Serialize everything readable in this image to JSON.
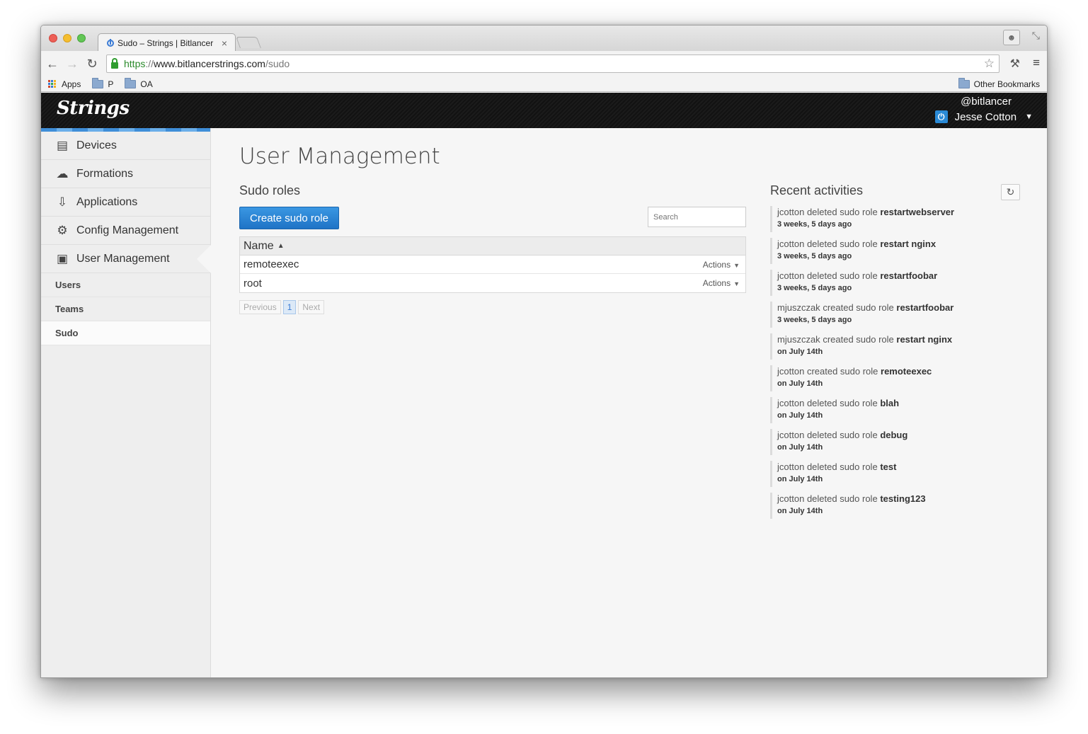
{
  "browser": {
    "tab_title": "Sudo – Strings | Bitlancer",
    "url_scheme": "https",
    "url_sep": "://",
    "url_host": "www.bitlancerstrings.com",
    "url_path": "/sudo",
    "bookmarks": [
      "Apps",
      "P",
      "OA"
    ],
    "other_bookmarks": "Other Bookmarks"
  },
  "header": {
    "logo": "Strings",
    "username": "@bitlancer",
    "display_name": "Jesse Cotton"
  },
  "sidebar": {
    "items": [
      {
        "label": "Devices",
        "icon": "server-icon"
      },
      {
        "label": "Formations",
        "icon": "cloud-upload-icon"
      },
      {
        "label": "Applications",
        "icon": "inbox-download-icon"
      },
      {
        "label": "Config Management",
        "icon": "gears-icon"
      },
      {
        "label": "User Management",
        "icon": "id-card-icon"
      }
    ],
    "subitems": [
      "Users",
      "Teams",
      "Sudo"
    ]
  },
  "main": {
    "page_title": "User Management",
    "section_title": "Sudo roles",
    "create_button": "Create sudo role",
    "search_placeholder": "Search",
    "table": {
      "column": "Name",
      "rows": [
        {
          "name": "remoteexec",
          "actions": "Actions"
        },
        {
          "name": "root",
          "actions": "Actions"
        }
      ]
    },
    "pagination": {
      "previous": "Previous",
      "current": "1",
      "next": "Next"
    }
  },
  "activities": {
    "title": "Recent activities",
    "items": [
      {
        "user": "jcotton",
        "verb": "deleted sudo role",
        "target": "restartwebserver",
        "time": "3 weeks, 5 days ago"
      },
      {
        "user": "jcotton",
        "verb": "deleted sudo role",
        "target": "restart nginx",
        "time": "3 weeks, 5 days ago"
      },
      {
        "user": "jcotton",
        "verb": "deleted sudo role",
        "target": "restartfoobar",
        "time": "3 weeks, 5 days ago"
      },
      {
        "user": "mjuszczak",
        "verb": "created sudo role",
        "target": "restartfoobar",
        "time": "3 weeks, 5 days ago"
      },
      {
        "user": "mjuszczak",
        "verb": "created sudo role",
        "target": "restart nginx",
        "time": "on July 14th"
      },
      {
        "user": "jcotton",
        "verb": "created sudo role",
        "target": "remoteexec",
        "time": "on July 14th"
      },
      {
        "user": "jcotton",
        "verb": "deleted sudo role",
        "target": "blah",
        "time": "on July 14th"
      },
      {
        "user": "jcotton",
        "verb": "deleted sudo role",
        "target": "debug",
        "time": "on July 14th"
      },
      {
        "user": "jcotton",
        "verb": "deleted sudo role",
        "target": "test",
        "time": "on July 14th"
      },
      {
        "user": "jcotton",
        "verb": "deleted sudo role",
        "target": "testing123",
        "time": "on July 14th"
      }
    ]
  }
}
